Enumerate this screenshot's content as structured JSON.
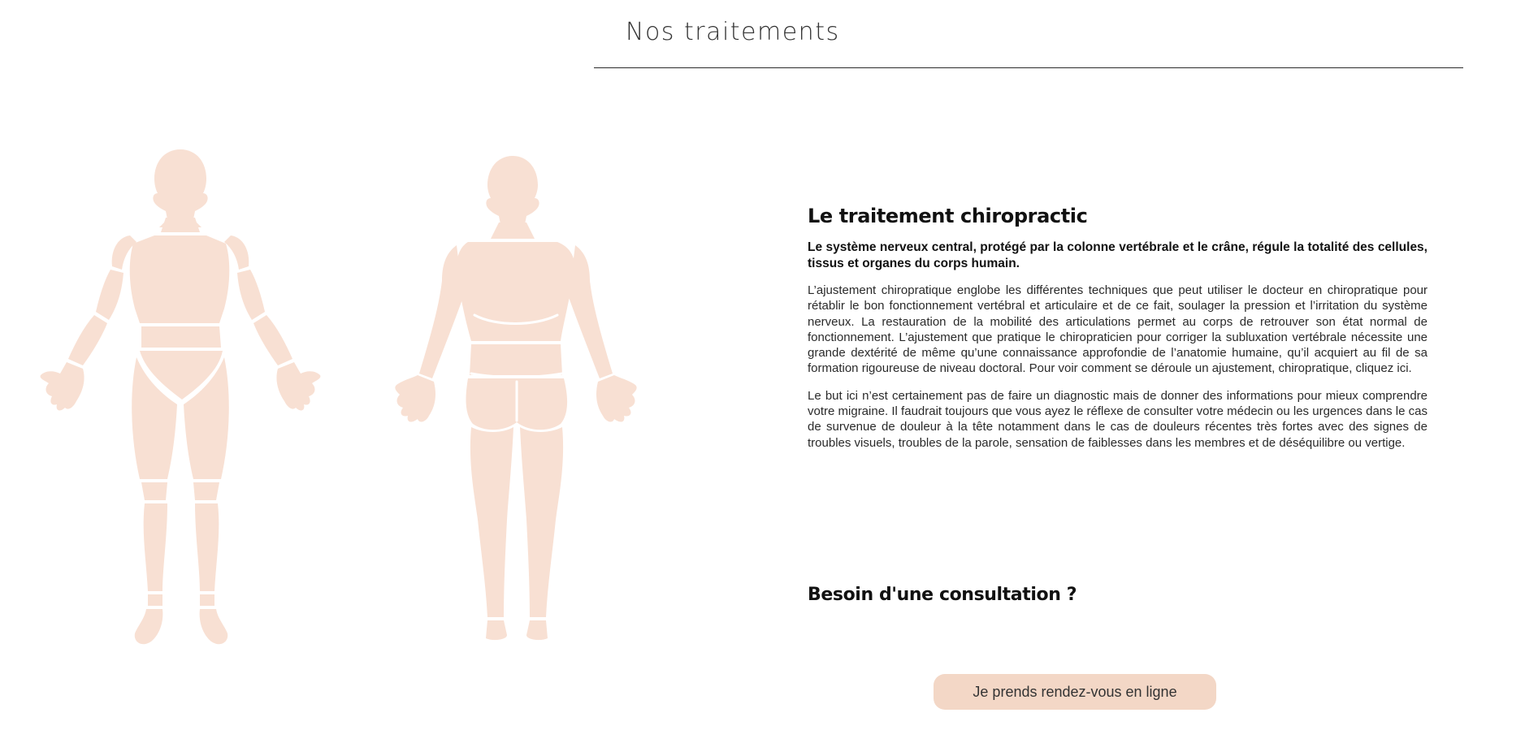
{
  "header": {
    "title": "Nos traitements"
  },
  "figures": {
    "color": "#f8e0d3",
    "front_icon": "human-body-front-icon",
    "back_icon": "human-body-back-icon"
  },
  "treatment": {
    "title": "Le traitement chiropractic",
    "lead": "Le système nerveux central, protégé par la colonne vertébrale et le crâne, régule la totalité des cellules, tissus et organes du corps humain.",
    "paragraph_1": "L’ajustement chiropratique englobe les différentes techniques que peut utiliser le docteur en chiropratique pour rétablir le bon fonctionnement vertébral et articulaire et de ce fait, soulager la pression et l’irritation du système nerveux. La restauration de la mobilité des articulations permet au corps de retrouver son état normal de fonctionnement. L’ajustement que pratique le chiropraticien pour corriger la subluxation vertébrale nécessite une grande dextérité de même qu’une connaissance approfondie de l’anatomie humaine, qu’il acquiert au fil de sa formation rigoureuse de niveau doctoral. Pour voir comment se déroule un ajustement, chiropratique, cliquez ici.",
    "paragraph_2": "Le but ici n’est certainement pas de faire un diagnostic mais de donner des informations pour mieux comprendre votre migraine. Il faudrait toujours que vous ayez le réflexe de consulter votre médecin ou les urgences dans le cas de survenue de douleur à la tête notamment dans le cas de douleurs récentes très fortes avec des signes de troubles visuels, troubles de la parole, sensation de faiblesses dans les membres et de déséquilibre ou vertige."
  },
  "consultation": {
    "title": "Besoin d'une consultation ?",
    "button_label": "Je prends rendez-vous en ligne",
    "button_color": "#f3d7c6"
  }
}
